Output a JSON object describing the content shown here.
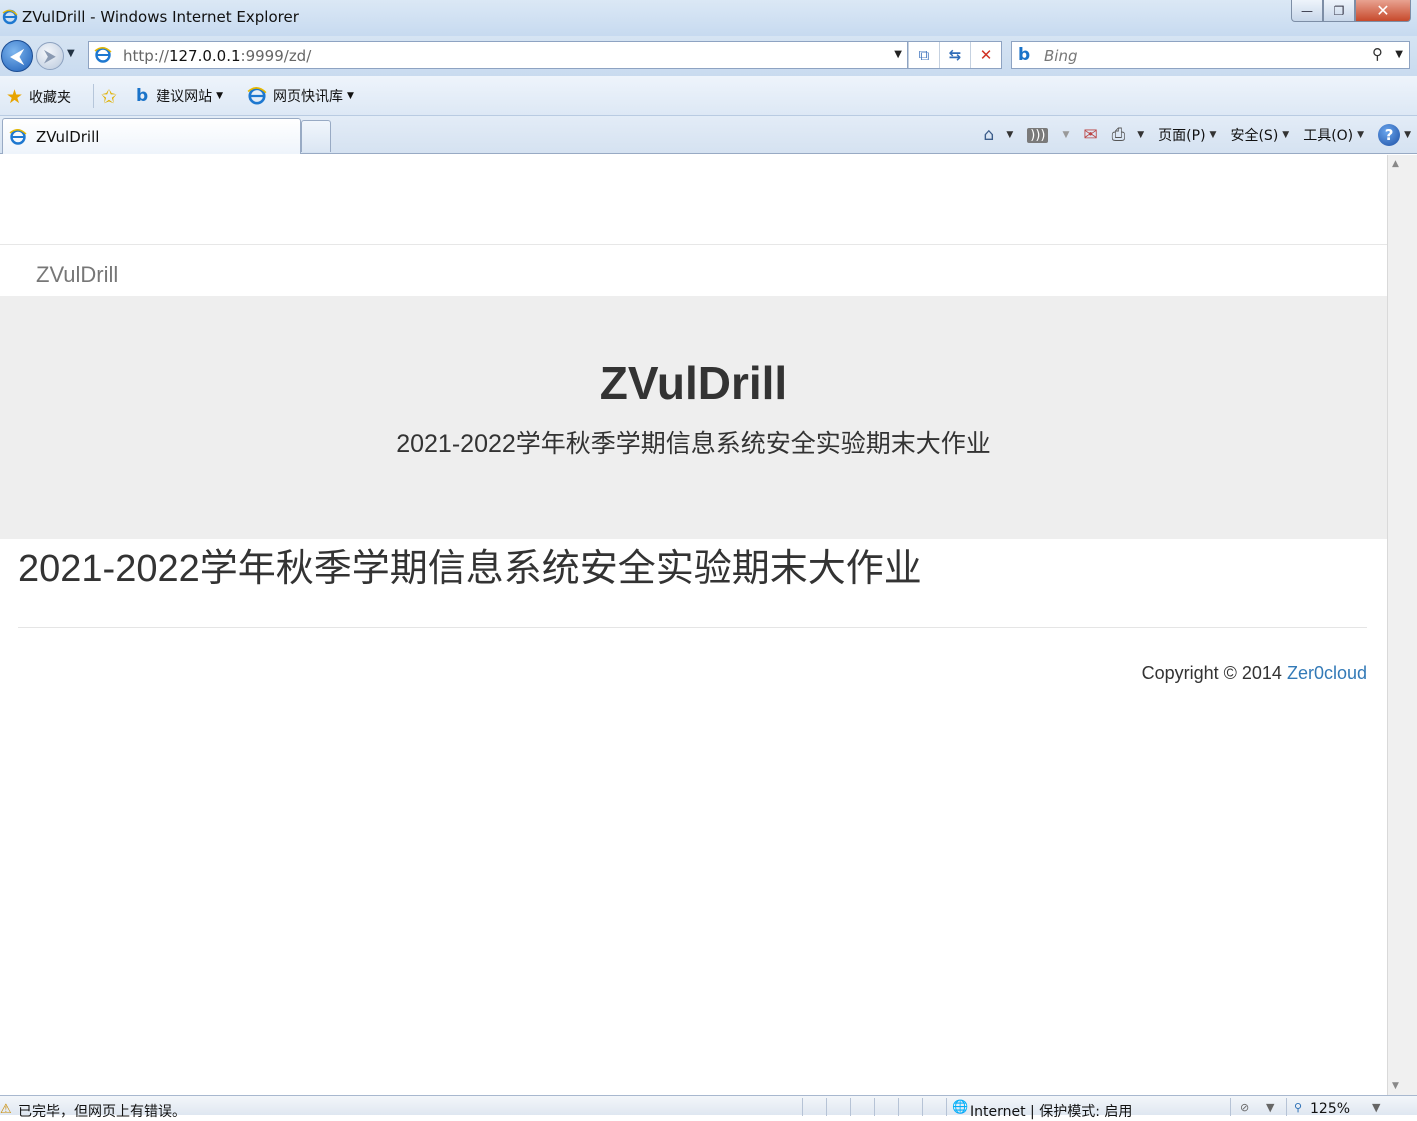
{
  "window": {
    "title": "ZVulDrill - Windows Internet Explorer",
    "minimize": "—",
    "restore": "❐",
    "close": "✕"
  },
  "address": {
    "url_prefix": "http://",
    "url_host": "127.0.0.1",
    "url_rest": ":9999/zd/",
    "search_placeholder": "Bing"
  },
  "favorites": {
    "favorites_label": "收藏夹",
    "suggested_sites": "建议网站",
    "web_slice_gallery": "网页快讯库"
  },
  "tab": {
    "label": "ZVulDrill"
  },
  "commands": {
    "page": "页面(P)",
    "safety": "安全(S)",
    "tools": "工具(O)",
    "help": "?"
  },
  "page": {
    "brand": "ZVulDrill",
    "jumbo_title": "ZVulDrill",
    "jumbo_subtitle": "2021-2022学年秋季学期信息系统安全实验期末大作业",
    "content_heading": "2021-2022学年秋季学期信息系统安全实验期末大作业",
    "footer_text": "Copyright © 2014 ",
    "footer_link": "Zer0cloud"
  },
  "status": {
    "message": "已完毕，但网页上有错误。",
    "zone": "Internet | 保护模式: 启用",
    "zoom": "125%"
  },
  "colors": {
    "link": "#337ab7",
    "jumbotron_bg": "#eeeeee"
  }
}
